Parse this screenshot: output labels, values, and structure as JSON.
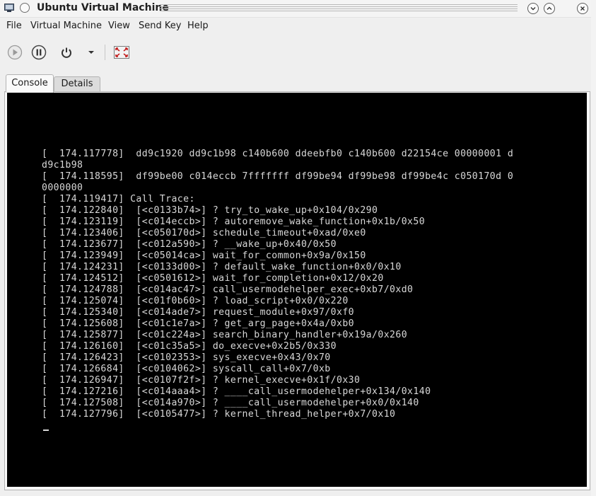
{
  "window": {
    "title": "Ubuntu Virtual Machine"
  },
  "menu": {
    "items": [
      {
        "label": "File"
      },
      {
        "label": "Virtual Machine"
      },
      {
        "label": "View"
      },
      {
        "label": "Send Key"
      },
      {
        "label": "Help"
      }
    ]
  },
  "toolbar": {
    "icons": [
      "run-icon",
      "pause-icon",
      "power-icon",
      "chevron-down-icon",
      "fullscreen-icon"
    ]
  },
  "tabs": [
    {
      "label": "Console",
      "active": true
    },
    {
      "label": "Details",
      "active": false
    }
  ],
  "console": {
    "lines": [
      "[  174.117778]  dd9c1920 dd9c1b98 c140b600 ddeebfb0 c140b600 d22154ce 00000001 d",
      "d9c1b98",
      "[  174.118595]  df99be00 c014eccb 7fffffff df99be94 df99be98 df99be4c c050170d 0",
      "0000000",
      "[  174.119417] Call Trace:",
      "[  174.122840]  [<c0133b74>] ? try_to_wake_up+0x104/0x290",
      "[  174.123119]  [<c014eccb>] ? autoremove_wake_function+0x1b/0x50",
      "[  174.123406]  [<c050170d>] schedule_timeout+0xad/0xe0",
      "[  174.123677]  [<c012a590>] ? __wake_up+0x40/0x50",
      "[  174.123949]  [<c05014ca>] wait_for_common+0x9a/0x150",
      "[  174.124231]  [<c0133d00>] ? default_wake_function+0x0/0x10",
      "[  174.124512]  [<c0501612>] wait_for_completion+0x12/0x20",
      "[  174.124788]  [<c014ac47>] call_usermodehelper_exec+0xb7/0xd0",
      "[  174.125074]  [<c01f0b60>] ? load_script+0x0/0x220",
      "[  174.125340]  [<c014ade7>] request_module+0x97/0xf0",
      "[  174.125608]  [<c01c1e7a>] ? get_arg_page+0x4a/0xb0",
      "[  174.125877]  [<c01c224a>] search_binary_handler+0x19a/0x260",
      "[  174.126160]  [<c01c35a5>] do_execve+0x2b5/0x330",
      "[  174.126423]  [<c0102353>] sys_execve+0x43/0x70",
      "[  174.126684]  [<c0104062>] syscall_call+0x7/0xb",
      "[  174.126947]  [<c0107f2f>] ? kernel_execve+0x1f/0x30",
      "[  174.127216]  [<c014aaa4>] ? ____call_usermodehelper+0x134/0x140",
      "[  174.127508]  [<c014a970>] ? ____call_usermodehelper+0x0/0x140",
      "[  174.127796]  [<c0105477>] ? kernel_thread_helper+0x7/0x10"
    ]
  }
}
